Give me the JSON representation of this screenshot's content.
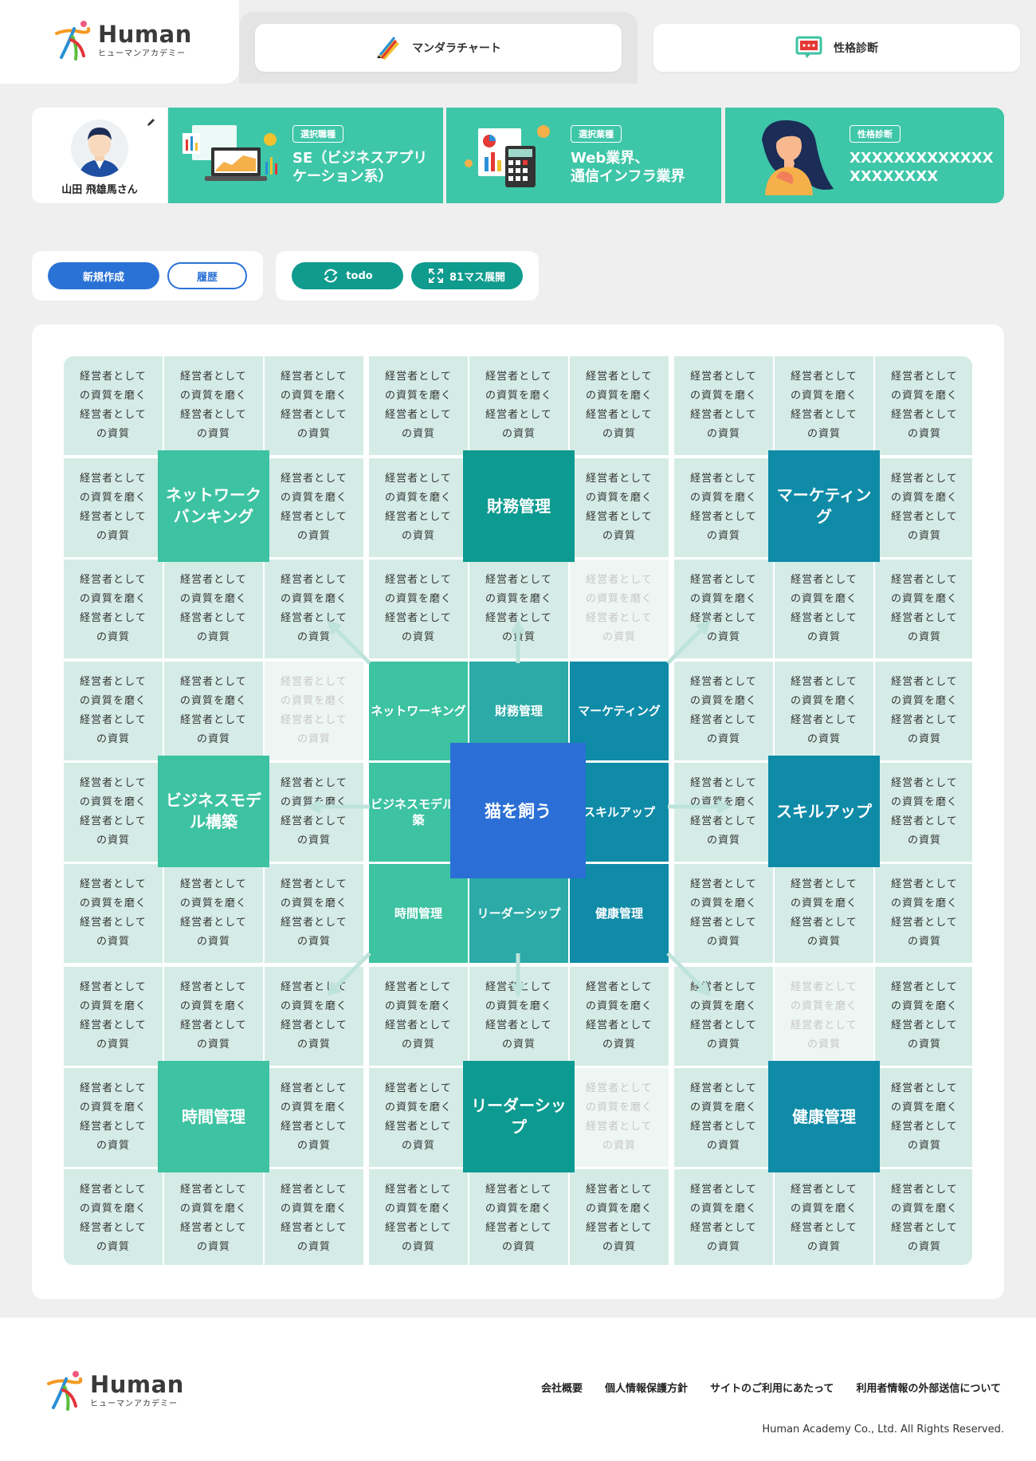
{
  "brand": {
    "name_en": "Human",
    "name_ja": "ヒューマンアカデミー"
  },
  "tabs": {
    "mandala": "マンダラチャート",
    "personality": "性格診断"
  },
  "profile": {
    "name": "山田 飛雄馬さん"
  },
  "cards": [
    {
      "tag": "選択職種",
      "line1": "SE（ビジネスアプリ",
      "line2": "ケーション系）"
    },
    {
      "tag": "選択業種",
      "line1": "Web業界、",
      "line2": "通信インフラ業界"
    },
    {
      "tag": "性格診断",
      "line1": "XXXXXXXXXXXXX",
      "line2": "XXXXXXXX"
    }
  ],
  "actions": {
    "new": "新規作成",
    "history": "履歴",
    "todo": "todo",
    "expand": "81マス展開"
  },
  "mandala": {
    "cell_text": [
      "経営者として",
      "の資質を磨く",
      "経営者として",
      "の資質"
    ],
    "center": "猫を飼う",
    "goals": [
      "ネットワークバンキング",
      "財務管理",
      "マーケティング",
      "ビジネスモデル構築",
      "スキルアップ",
      "時間管理",
      "リーダーシップ",
      "健康管理"
    ],
    "inner_labels": [
      "ネットワーキング",
      "財務管理",
      "マーケティング",
      "ビジネスモデル構築",
      "スキルアップ",
      "時間管理",
      "リーダーシップ",
      "健康管理"
    ],
    "colors": {
      "teal": "#3dc2a2",
      "teal2": "#2baaa7",
      "cyan": "#0f8ba8",
      "blue": "#1a72b6",
      "center": "#2b6fd6"
    }
  },
  "footer": {
    "links": [
      "会社概要",
      "個人情報保護方針",
      "サイトのご利用にあたって",
      "利用者情報の外部送信について"
    ],
    "copyright": "Human Academy Co., Ltd. All Rights Reserved."
  }
}
